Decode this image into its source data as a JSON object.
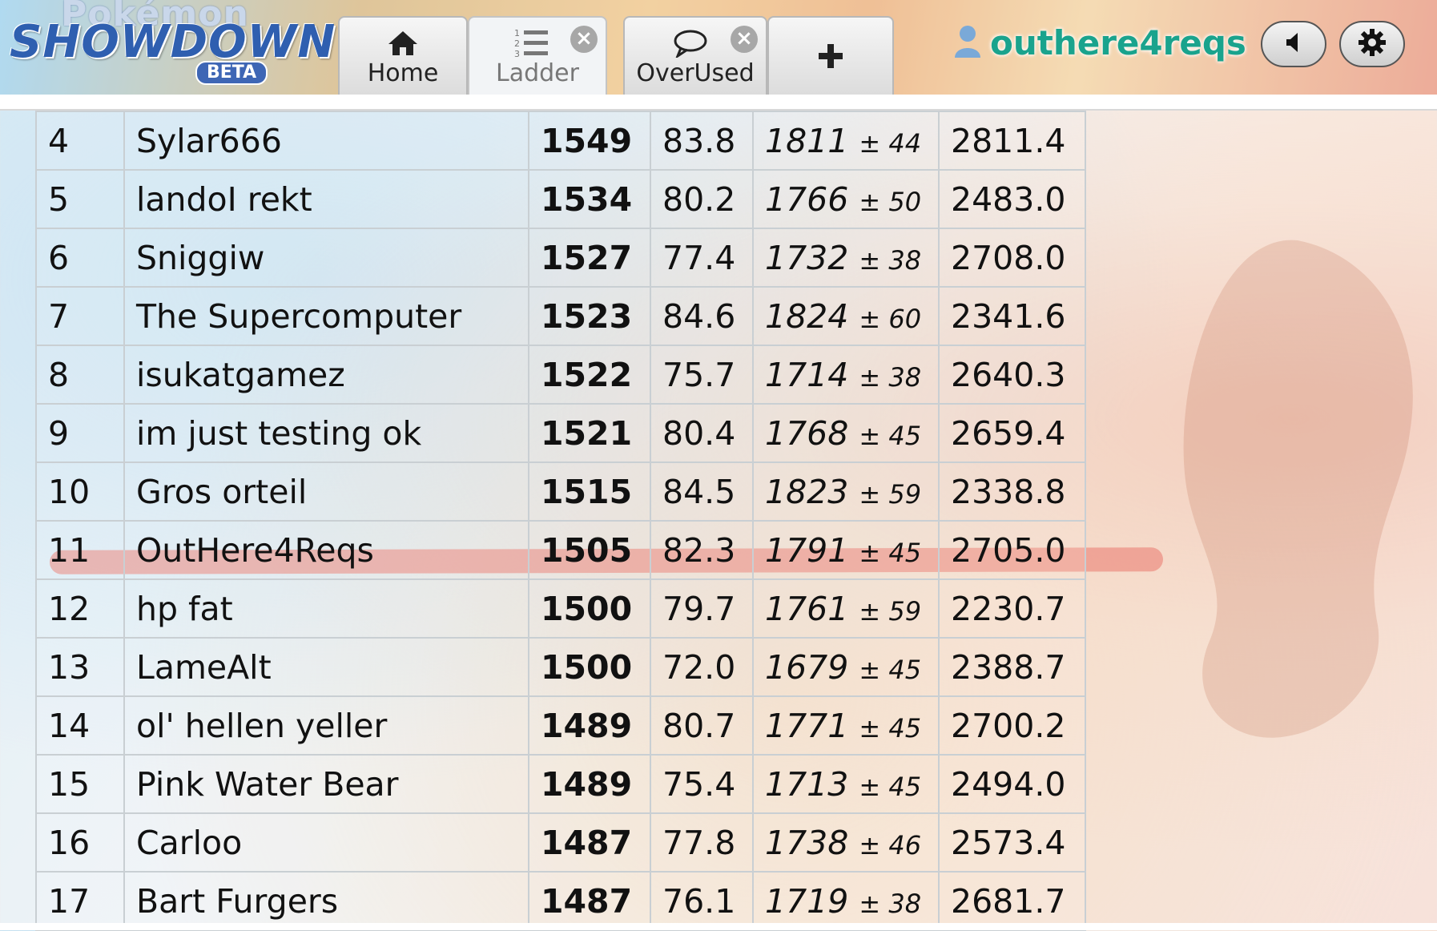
{
  "app": {
    "logo_top": "Pokémon",
    "logo_main": "SHOWDOWN",
    "logo_badge": "BETA"
  },
  "tabs": [
    {
      "label": "Home",
      "icon": "home-icon",
      "active": false,
      "closable": false
    },
    {
      "label": "Ladder",
      "icon": "ladder-list-icon",
      "active": true,
      "closable": true
    },
    {
      "label": "OverUsed",
      "icon": "chat-bubble-icon",
      "active": false,
      "closable": true
    },
    {
      "label": "+",
      "icon": "plus-icon",
      "active": false,
      "closable": false
    }
  ],
  "user": {
    "name": "outhere4reqs",
    "icon": "user-icon",
    "name_color": "#1aa38d"
  },
  "controls": {
    "sound_icon": "speaker-icon",
    "settings_icon": "gear-icon"
  },
  "ladder": {
    "rows": [
      {
        "rank": "4",
        "name": "Sylar666",
        "elo": "1549",
        "gxe": "83.8",
        "glicko": "1811",
        "dev": "± 44",
        "coil": "2811.4"
      },
      {
        "rank": "5",
        "name": "landoI rekt",
        "elo": "1534",
        "gxe": "80.2",
        "glicko": "1766",
        "dev": "± 50",
        "coil": "2483.0"
      },
      {
        "rank": "6",
        "name": "Sniggiw",
        "elo": "1527",
        "gxe": "77.4",
        "glicko": "1732",
        "dev": "± 38",
        "coil": "2708.0"
      },
      {
        "rank": "7",
        "name": "The Supercomputer",
        "elo": "1523",
        "gxe": "84.6",
        "glicko": "1824",
        "dev": "± 60",
        "coil": "2341.6"
      },
      {
        "rank": "8",
        "name": "isukatgamez",
        "elo": "1522",
        "gxe": "75.7",
        "glicko": "1714",
        "dev": "± 38",
        "coil": "2640.3"
      },
      {
        "rank": "9",
        "name": "im just testing ok",
        "elo": "1521",
        "gxe": "80.4",
        "glicko": "1768",
        "dev": "± 45",
        "coil": "2659.4"
      },
      {
        "rank": "10",
        "name": "Gros orteil",
        "elo": "1515",
        "gxe": "84.5",
        "glicko": "1823",
        "dev": "± 59",
        "coil": "2338.8"
      },
      {
        "rank": "11",
        "name": "OutHere4Reqs",
        "elo": "1505",
        "gxe": "82.3",
        "glicko": "1791",
        "dev": "± 45",
        "coil": "2705.0",
        "highlighted": true
      },
      {
        "rank": "12",
        "name": "hp fat",
        "elo": "1500",
        "gxe": "79.7",
        "glicko": "1761",
        "dev": "± 59",
        "coil": "2230.7"
      },
      {
        "rank": "13",
        "name": "LameAlt",
        "elo": "1500",
        "gxe": "72.0",
        "glicko": "1679",
        "dev": "± 45",
        "coil": "2388.7"
      },
      {
        "rank": "14",
        "name": "ol' hellen yeller",
        "elo": "1489",
        "gxe": "80.7",
        "glicko": "1771",
        "dev": "± 45",
        "coil": "2700.2"
      },
      {
        "rank": "15",
        "name": "Pink Water Bear",
        "elo": "1489",
        "gxe": "75.4",
        "glicko": "1713",
        "dev": "± 45",
        "coil": "2494.0"
      },
      {
        "rank": "16",
        "name": "Carloo",
        "elo": "1487",
        "gxe": "77.8",
        "glicko": "1738",
        "dev": "± 46",
        "coil": "2573.4"
      },
      {
        "rank": "17",
        "name": "Bart Furgers",
        "elo": "1487",
        "gxe": "76.1",
        "glicko": "1719",
        "dev": "± 38",
        "coil": "2681.7"
      }
    ],
    "highlight_color": "#ea786e"
  }
}
